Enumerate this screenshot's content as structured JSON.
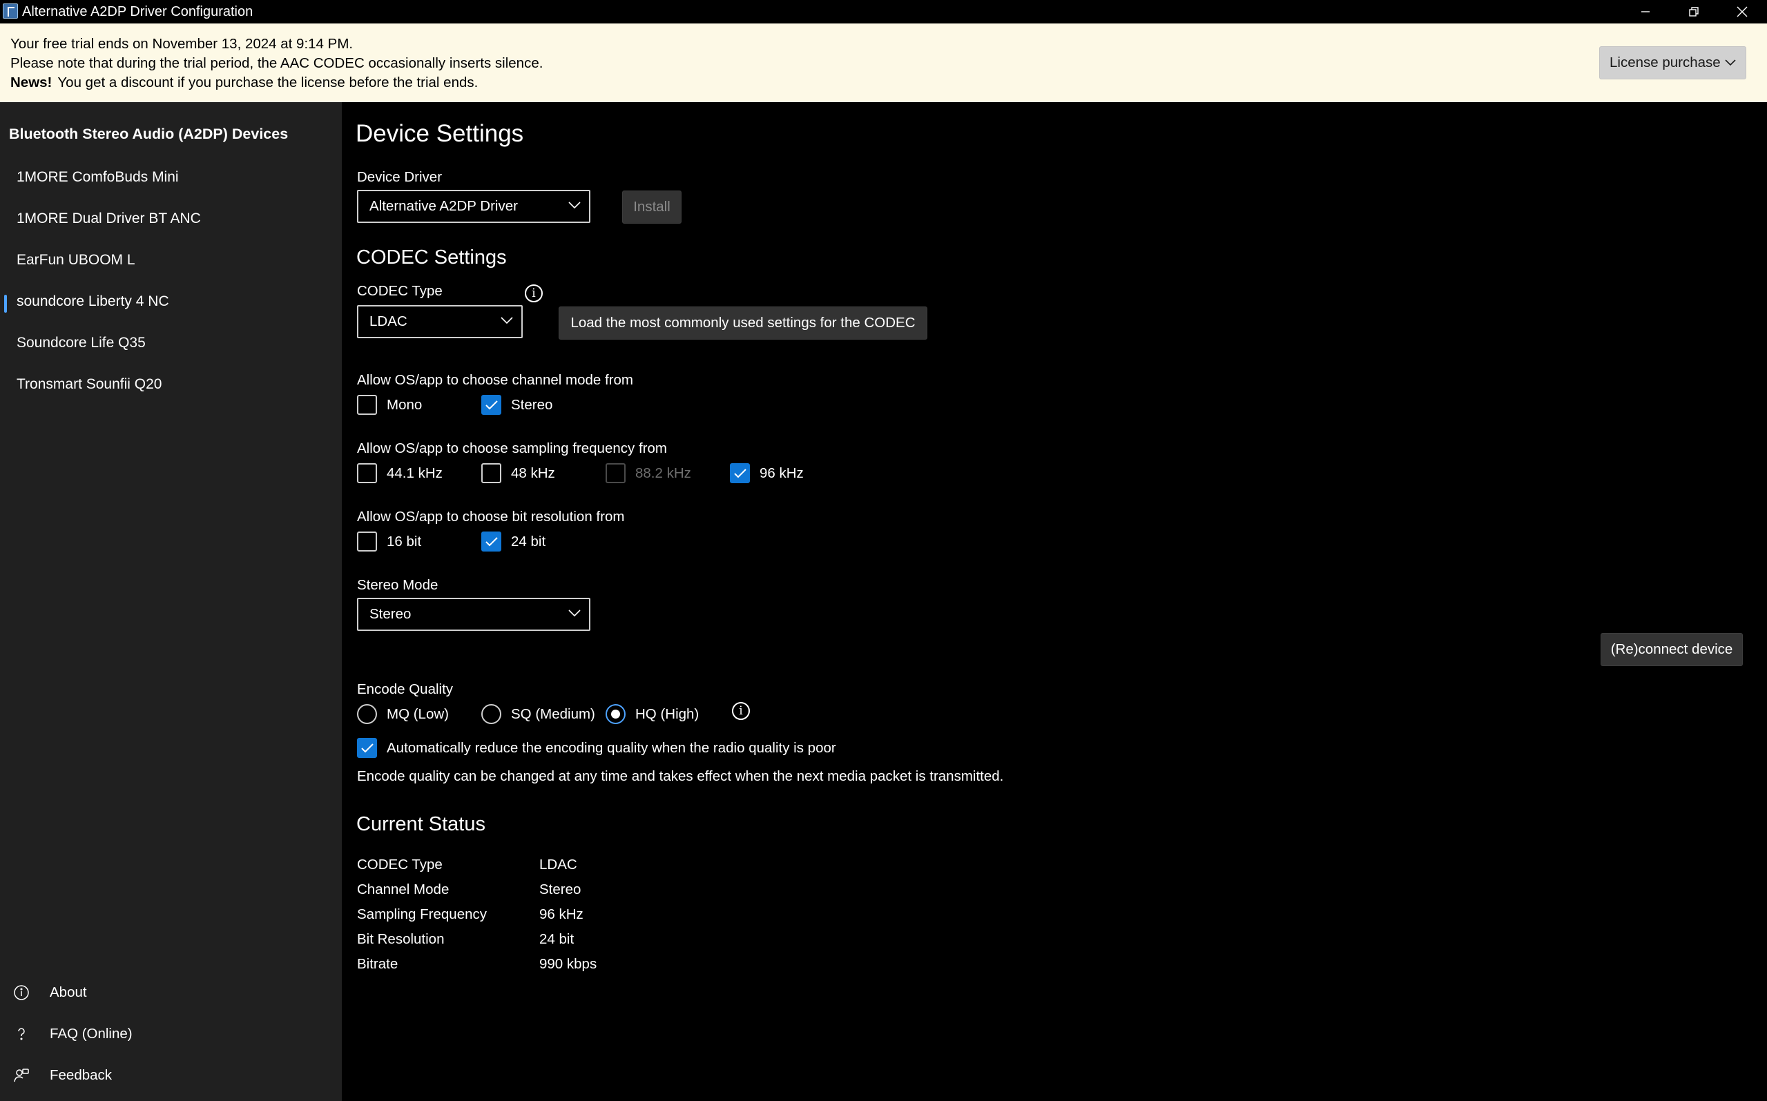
{
  "window": {
    "title": "Alternative A2DP Driver Configuration"
  },
  "banner": {
    "line1": "Your free trial ends on November 13, 2024 at 9:14 PM.",
    "line2": "Please note that during the trial period, the AAC CODEC occasionally inserts silence.",
    "news_label": "News!",
    "news_text": "You get a discount if you purchase the license before the trial ends.",
    "license_button": "License purchase"
  },
  "sidebar": {
    "heading": "Bluetooth Stereo Audio (A2DP) Devices",
    "devices": [
      {
        "label": "1MORE ComfoBuds Mini"
      },
      {
        "label": "1MORE Dual Driver BT ANC"
      },
      {
        "label": "EarFun UBOOM L"
      },
      {
        "label": "soundcore Liberty 4 NC",
        "selected": true
      },
      {
        "label": "Soundcore Life Q35"
      },
      {
        "label": "Tronsmart Sounfii Q20"
      }
    ],
    "footer": [
      {
        "label": "About",
        "icon": "info-icon"
      },
      {
        "label": "FAQ (Online)",
        "icon": "help-icon"
      },
      {
        "label": "Feedback",
        "icon": "feedback-icon"
      }
    ]
  },
  "device_settings": {
    "title": "Device Settings",
    "driver_label": "Device Driver",
    "driver_value": "Alternative A2DP Driver",
    "install_button": "Install"
  },
  "codec_settings": {
    "title": "CODEC Settings",
    "codec_type_label": "CODEC Type",
    "codec_type_value": "LDAC",
    "load_defaults_button": "Load the most commonly used settings for the CODEC",
    "channel_label": "Allow OS/app to choose channel mode from",
    "channel_options": {
      "mono": "Mono",
      "stereo": "Stereo"
    },
    "sampling_label": "Allow OS/app to choose sampling frequency from",
    "sampling_options": {
      "f441": "44.1 kHz",
      "f48": "48 kHz",
      "f882": "88.2 kHz",
      "f96": "96 kHz"
    },
    "bit_label": "Allow OS/app to choose bit resolution from",
    "bit_options": {
      "b16": "16 bit",
      "b24": "24 bit"
    },
    "stereo_mode_label": "Stereo Mode",
    "stereo_mode_value": "Stereo",
    "reconnect_button": "(Re)connect device",
    "encode_quality_label": "Encode Quality",
    "encode_options": {
      "mq": "MQ (Low)",
      "sq": "SQ (Medium)",
      "hq": "HQ (High)"
    },
    "auto_reduce_label": "Automatically reduce the encoding quality when the radio quality is poor",
    "encode_note": "Encode quality can be changed at any time and takes effect when the next media packet is transmitted."
  },
  "current_status": {
    "title": "Current Status",
    "rows": [
      {
        "key": "CODEC Type",
        "value": "LDAC"
      },
      {
        "key": "Channel Mode",
        "value": "Stereo"
      },
      {
        "key": "Sampling Frequency",
        "value": "96 kHz"
      },
      {
        "key": "Bit Resolution",
        "value": "24 bit"
      },
      {
        "key": "Bitrate",
        "value": "990 kbps"
      }
    ]
  },
  "colors": {
    "accent": "#0f77d6",
    "sidebar_bg": "#202020",
    "banner_bg": "#fdf9e6"
  }
}
